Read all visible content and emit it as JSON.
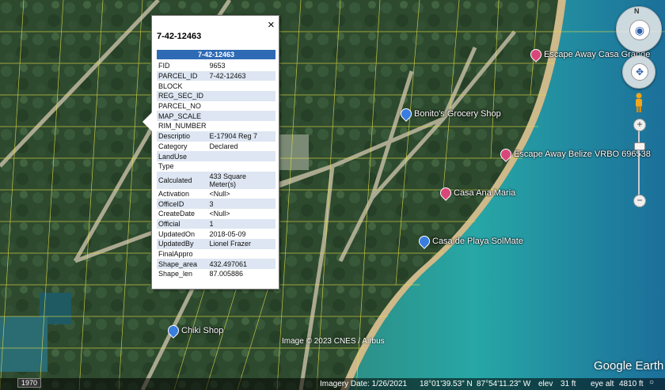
{
  "popup": {
    "title": "7-42-12463",
    "header": "7-42-12463",
    "close_label": "×",
    "fields": [
      {
        "key": "FID",
        "value": "9653"
      },
      {
        "key": "PARCEL_ID",
        "value": "7-42-12463"
      },
      {
        "key": "BLOCK",
        "value": ""
      },
      {
        "key": "REG_SEC_ID",
        "value": ""
      },
      {
        "key": "PARCEL_NO",
        "value": ""
      },
      {
        "key": "MAP_SCALE",
        "value": ""
      },
      {
        "key": "RIM_NUMBER",
        "value": ""
      },
      {
        "key": "Descriptio",
        "value": "E-17904 Reg 7"
      },
      {
        "key": "Category",
        "value": "Declared"
      },
      {
        "key": "LandUse",
        "value": ""
      },
      {
        "key": "Type",
        "value": ""
      },
      {
        "key": "Calculated",
        "value": "433 Square Meter(s)"
      },
      {
        "key": "Activation",
        "value": "<Null>"
      },
      {
        "key": "OfficeID",
        "value": "3"
      },
      {
        "key": "CreateDate",
        "value": "<Null>"
      },
      {
        "key": "Official",
        "value": "1"
      },
      {
        "key": "UpdatedOn",
        "value": "2018-05-09"
      },
      {
        "key": "UpdatedBy",
        "value": "Lionel Frazer"
      },
      {
        "key": "FinalAppro",
        "value": ""
      },
      {
        "key": "Shape_area",
        "value": "432.497061"
      },
      {
        "key": "Shape_len",
        "value": "87.005886"
      }
    ]
  },
  "places": {
    "escape_away_casa_grande": "Escape Away Casa Grande",
    "bonitos_grocery": "Bonito's Grocery Shop",
    "escape_away_belize": "Escape Away Belize VRBO 696538",
    "casa_ana_maria": "Casa Ana Maria",
    "casa_de_playa": "Casa de Playa SolMate",
    "chiki_shop": "Chiki Shop"
  },
  "map": {
    "copyright": "Image © 2023 CNES / Airbus",
    "logo": "Google Earth",
    "year": "1970"
  },
  "statusbar": {
    "imagery_date": "Imagery Date: 1/26/2021",
    "lat": "18°01'39.53\" N",
    "lon": "87°54'11.23\" W",
    "elev_label": "elev",
    "elev": "31 ft",
    "eye_alt_label": "eye alt",
    "eye_alt": "4810 ft"
  },
  "controls": {
    "compass_north": "N",
    "zoom_in": "+",
    "zoom_out": "−"
  },
  "colors": {
    "accent": "#2f6bb5",
    "parcel_lines": "#e5e14a",
    "sea": "#2aa0a0"
  }
}
